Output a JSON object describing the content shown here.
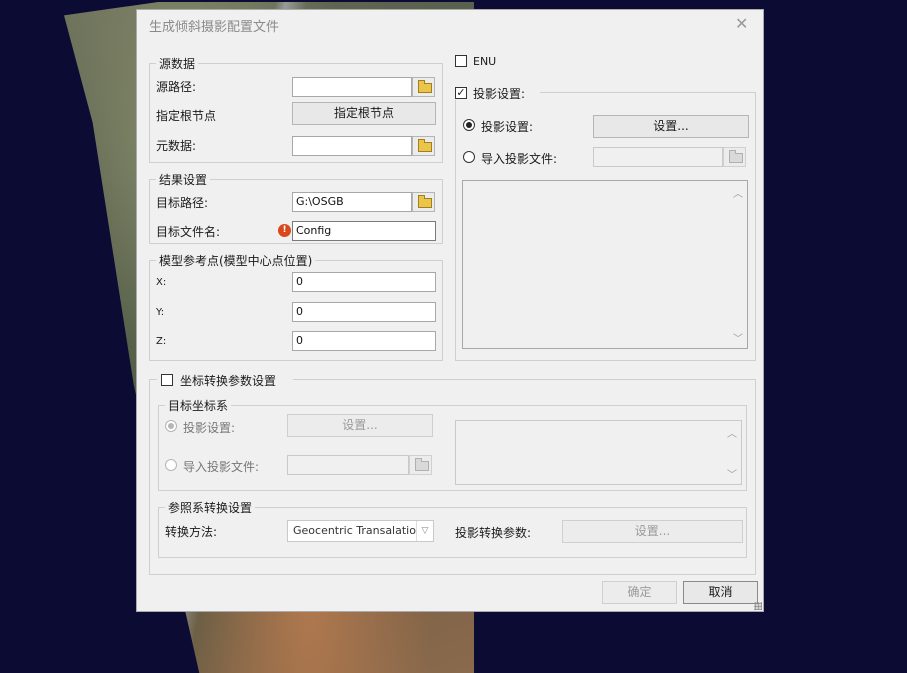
{
  "window": {
    "title": "生成倾斜摄影配置文件",
    "close_glyph": "✕"
  },
  "source_group": {
    "legend": "源数据",
    "source_path_label": "源路径:",
    "source_path_value": "",
    "root_node_label": "指定根节点",
    "root_node_button": "指定根节点",
    "metadata_label": "元数据:",
    "metadata_value": ""
  },
  "result_group": {
    "legend": "结果设置",
    "target_path_label": "目标路径:",
    "target_path_value": "G:\\OSGB",
    "target_file_label": "目标文件名:",
    "target_file_value": "Config",
    "error_glyph": "!"
  },
  "ref_point_group": {
    "legend": "模型参考点(模型中心点位置)",
    "x_label": "X:",
    "x_value": "0",
    "y_label": "Y:",
    "y_value": "0",
    "z_label": "Z:",
    "z_value": "0"
  },
  "enu": {
    "label": "ENU",
    "checked": false
  },
  "projection_group": {
    "legend": "投影设置:",
    "checked": true,
    "check_glyph": "✓",
    "proj_setting_label": "投影设置:",
    "proj_setting_button": "设置...",
    "import_file_label": "导入投影文件:",
    "import_file_value": ""
  },
  "coord_transform": {
    "legend": "坐标转换参数设置",
    "checked": false,
    "target_crs_legend": "目标坐标系",
    "proj_setting_label": "投影设置:",
    "proj_setting_button": "设置...",
    "import_file_label": "导入投影文件:",
    "import_file_value": "",
    "ref_transform_legend": "参照系转换设置",
    "method_label": "转换方法:",
    "method_value": "Geocentric Transalation",
    "params_label": "投影转换参数:",
    "params_button": "设置..."
  },
  "footer": {
    "ok_button": "确定",
    "cancel_button": "取消"
  },
  "icons": {
    "scroll_up": "︿",
    "scroll_down": "﹀",
    "combo_arrow": "▽"
  }
}
